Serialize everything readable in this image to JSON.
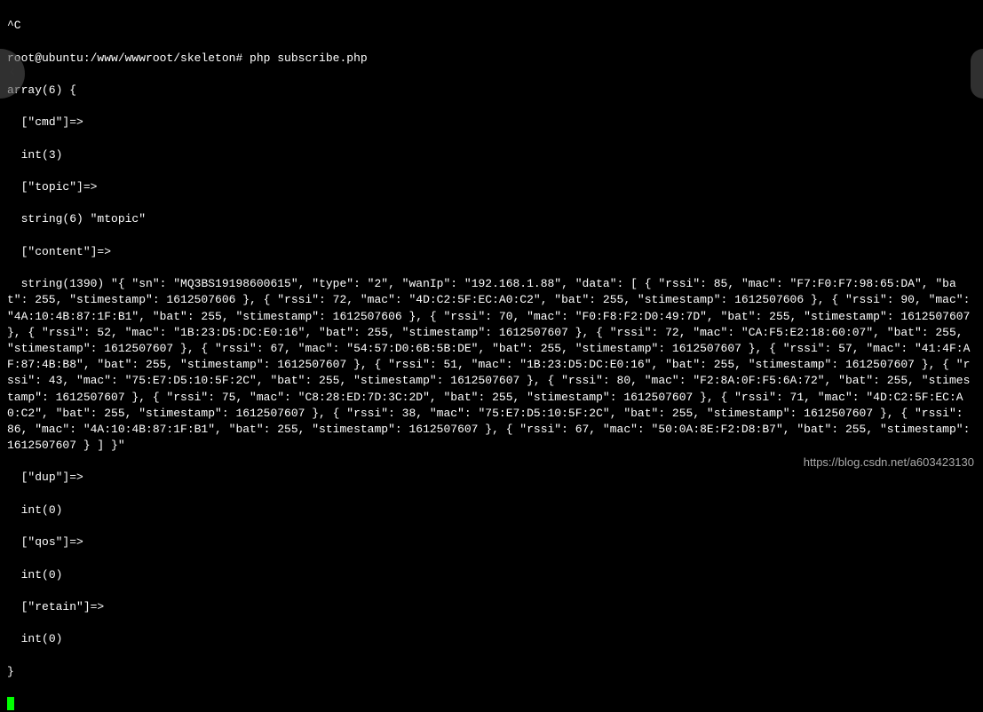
{
  "terminal": {
    "interrupt": "^C",
    "prompt": "root@ubuntu:/www/wwwroot/skeleton# php subscribe.php",
    "array_header": "array(6) {",
    "cmd_key": "  [\"cmd\"]=>",
    "cmd_val": "  int(3)",
    "topic_key": "  [\"topic\"]=>",
    "topic_val": "  string(6) \"mtopic\"",
    "content_key": "  [\"content\"]=>",
    "content_val": "  string(1390) \"{ \"sn\": \"MQ3BS19198600615\", \"type\": \"2\", \"wanIp\": \"192.168.1.88\", \"data\": [ { \"rssi\": 85, \"mac\": \"F7:F0:F7:98:65:DA\", \"bat\": 255, \"stimestamp\": 1612507606 }, { \"rssi\": 72, \"mac\": \"4D:C2:5F:EC:A0:C2\", \"bat\": 255, \"stimestamp\": 1612507606 }, { \"rssi\": 90, \"mac\": \"4A:10:4B:87:1F:B1\", \"bat\": 255, \"stimestamp\": 1612507606 }, { \"rssi\": 70, \"mac\": \"F0:F8:F2:D0:49:7D\", \"bat\": 255, \"stimestamp\": 1612507607 }, { \"rssi\": 52, \"mac\": \"1B:23:D5:DC:E0:16\", \"bat\": 255, \"stimestamp\": 1612507607 }, { \"rssi\": 72, \"mac\": \"CA:F5:E2:18:60:07\", \"bat\": 255, \"stimestamp\": 1612507607 }, { \"rssi\": 67, \"mac\": \"54:57:D0:6B:5B:DE\", \"bat\": 255, \"stimestamp\": 1612507607 }, { \"rssi\": 57, \"mac\": \"41:4F:AF:87:4B:B8\", \"bat\": 255, \"stimestamp\": 1612507607 }, { \"rssi\": 51, \"mac\": \"1B:23:D5:DC:E0:16\", \"bat\": 255, \"stimestamp\": 1612507607 }, { \"rssi\": 43, \"mac\": \"75:E7:D5:10:5F:2C\", \"bat\": 255, \"stimestamp\": 1612507607 }, { \"rssi\": 80, \"mac\": \"F2:8A:0F:F5:6A:72\", \"bat\": 255, \"stimestamp\": 1612507607 }, { \"rssi\": 75, \"mac\": \"C8:28:ED:7D:3C:2D\", \"bat\": 255, \"stimestamp\": 1612507607 }, { \"rssi\": 71, \"mac\": \"4D:C2:5F:EC:A0:C2\", \"bat\": 255, \"stimestamp\": 1612507607 }, { \"rssi\": 38, \"mac\": \"75:E7:D5:10:5F:2C\", \"bat\": 255, \"stimestamp\": 1612507607 }, { \"rssi\": 86, \"mac\": \"4A:10:4B:87:1F:B1\", \"bat\": 255, \"stimestamp\": 1612507607 }, { \"rssi\": 67, \"mac\": \"50:0A:8E:F2:D8:B7\", \"bat\": 255, \"stimestamp\": 1612507607 } ] }\"",
    "dup_key": "  [\"dup\"]=>",
    "dup_val": "  int(0)",
    "qos_key": "  [\"qos\"]=>",
    "qos_val": "  int(0)",
    "retain_key": "  [\"retain\"]=>",
    "retain_val": "  int(0)",
    "array_footer": "}"
  },
  "watermark": "https://blog.csdn.net/a603423130",
  "nav": {
    "left_glyph": "‹"
  }
}
